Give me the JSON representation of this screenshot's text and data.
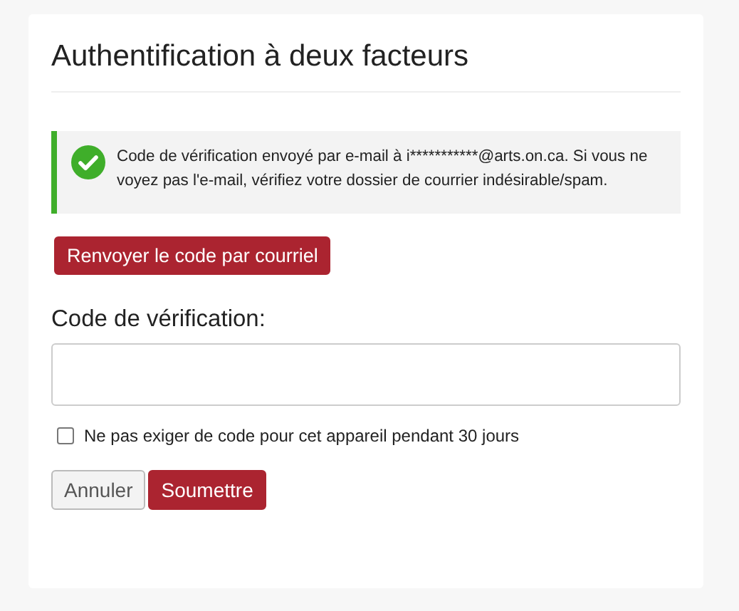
{
  "title": "Authentification à deux facteurs",
  "alert": {
    "kind": "success",
    "message": "Code de vérification envoyé par e-mail à i***********@arts.on.ca. Si vous ne voyez pas l'e-mail, vérifiez votre dossier de courrier indésirable/spam."
  },
  "resend_button": "Renvoyer le code par courriel",
  "code_field": {
    "label": "Code de vérification:"
  },
  "remember_device": {
    "label": "Ne pas exiger de code pour cet appareil pendant 30 jours",
    "checked": false
  },
  "buttons": [
    {
      "label": "Annuler",
      "kind": "secondary"
    },
    {
      "label": "Soumettre",
      "kind": "primary"
    }
  ]
}
